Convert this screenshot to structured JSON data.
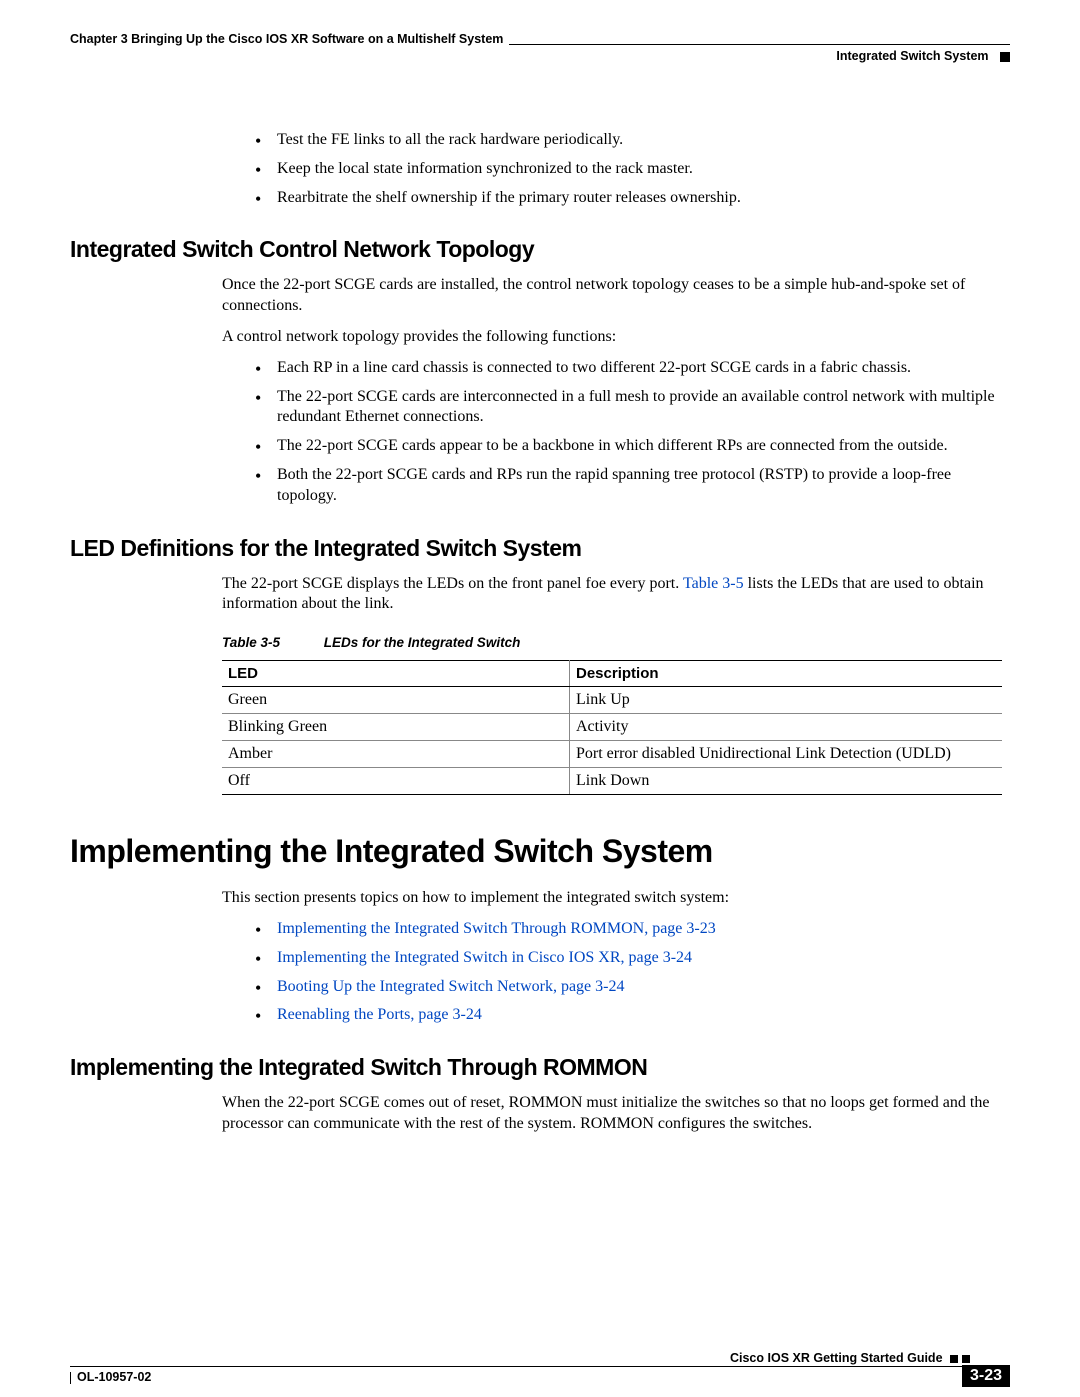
{
  "header": {
    "chapter": "Chapter 3      Bringing Up the Cisco IOS XR Software on a Multishelf System",
    "section": "Integrated Switch System"
  },
  "intro_bullets": [
    "Test the FE links to all the rack hardware periodically.",
    "Keep the local state information synchronized to the rack master.",
    "Rearbitrate the shelf ownership if the primary router releases ownership."
  ],
  "sec_topology": {
    "title": "Integrated Switch Control Network Topology",
    "p1": "Once the 22-port SCGE cards are installed, the control network topology ceases to be a simple hub-and-spoke set of connections.",
    "p2": "A control network topology provides the following functions:",
    "bullets": [
      "Each RP in a line card chassis is connected to two different 22-port SCGE cards in a fabric chassis.",
      "The 22-port SCGE cards are interconnected in a full mesh to provide an available control network with multiple redundant Ethernet connections.",
      "The 22-port SCGE cards appear to be a backbone in which different RPs are connected from the outside.",
      "Both the 22-port SCGE cards and RPs run the rapid spanning tree protocol (RSTP) to provide a loop-free topology."
    ]
  },
  "sec_led": {
    "title": "LED Definitions for the Integrated Switch System",
    "p1_a": "The 22-port SCGE displays the LEDs on the front panel foe every port. ",
    "p1_link": "Table 3-5",
    "p1_b": " lists the LEDs that are used to obtain information about the link.",
    "table_caption_num": "Table 3-5",
    "table_caption_title": "LEDs for the Integrated Switch",
    "table_header_1": "LED",
    "table_header_2": "Description",
    "rows": [
      {
        "led": "Green",
        "desc": "Link Up"
      },
      {
        "led": "Blinking Green",
        "desc": "Activity"
      },
      {
        "led": "Amber",
        "desc": "Port error disabled Unidirectional Link Detection (UDLD)"
      },
      {
        "led": "Off",
        "desc": "Link Down"
      }
    ]
  },
  "sec_impl": {
    "title": "Implementing the Integrated Switch System",
    "p1": "This section presents topics on how to implement the integrated switch system:",
    "links": [
      "Implementing the Integrated Switch Through ROMMON, page 3-23",
      "Implementing the Integrated Switch in Cisco IOS XR, page 3-24",
      "Booting Up the Integrated Switch Network, page 3-24",
      "Reenabling the Ports, page 3-24"
    ]
  },
  "sec_rommon": {
    "title": "Implementing the Integrated Switch Through ROMMON",
    "p1": "When the 22-port SCGE comes out of reset, ROMMON must initialize the switches so that no loops get formed and the processor can communicate with the rest of the system. ROMMON configures the switches."
  },
  "footer": {
    "guide": "Cisco IOS XR Getting Started Guide",
    "doc": "OL-10957-02",
    "page": "3-23"
  }
}
